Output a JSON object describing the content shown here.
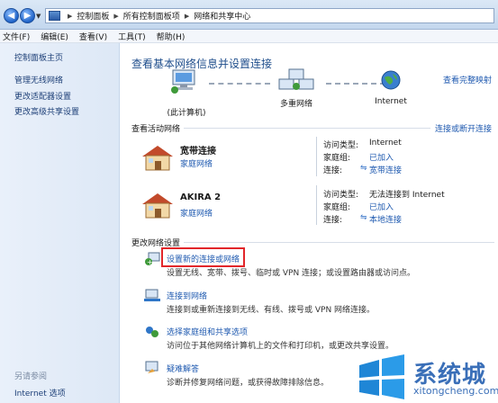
{
  "breadcrumb": [
    "控制面板",
    "所有控制面板项",
    "网络和共享中心"
  ],
  "menu": [
    "文件(F)",
    "编辑(E)",
    "查看(V)",
    "工具(T)",
    "帮助(H)"
  ],
  "sidebar": {
    "home": "控制面板主页",
    "links": [
      "管理无线网络",
      "更改适配器设置",
      "更改高级共享设置"
    ],
    "see_also_title": "另请参阅",
    "see_also": [
      "Internet 选项"
    ]
  },
  "main": {
    "title": "查看基本网络信息并设置连接",
    "full_map": "查看完整映射",
    "map": {
      "this_pc": "(此计算机)",
      "multi_network": "多重网络",
      "internet": "Internet"
    },
    "active_title": "查看活动网络",
    "connect_disconnect": "连接或断开连接",
    "networks": [
      {
        "name": "宽带连接",
        "type": "家庭网络",
        "access_label": "访问类型:",
        "access_value": "Internet",
        "homegroup_label": "家庭组:",
        "homegroup_value": "已加入",
        "conn_label": "连接:",
        "conn_value": "宽带连接"
      },
      {
        "name": "AKIRA 2",
        "type": "家庭网络",
        "access_label": "访问类型:",
        "access_value": "无法连接到 Internet",
        "homegroup_label": "家庭组:",
        "homegroup_value": "已加入",
        "conn_label": "连接:",
        "conn_value": "本地连接"
      }
    ],
    "change_title": "更改网络设置",
    "tasks": [
      {
        "link": "设置新的连接或网络",
        "desc": "设置无线、宽带、拨号、临时或 VPN 连接；或设置路由器或访问点。"
      },
      {
        "link": "连接到网络",
        "desc": "连接到或重新连接到无线、有线、拨号或 VPN 网络连接。"
      },
      {
        "link": "选择家庭组和共享选项",
        "desc": "访问位于其他网络计算机上的文件和打印机，或更改共享设置。"
      },
      {
        "link": "疑难解答",
        "desc": "诊断并修复网络问题，或获得故障排除信息。"
      }
    ]
  },
  "watermark": {
    "text": "系统城",
    "url": "xitongcheng.com"
  },
  "colors": {
    "link": "#1f5ab0",
    "highlight": "#e2262a"
  }
}
